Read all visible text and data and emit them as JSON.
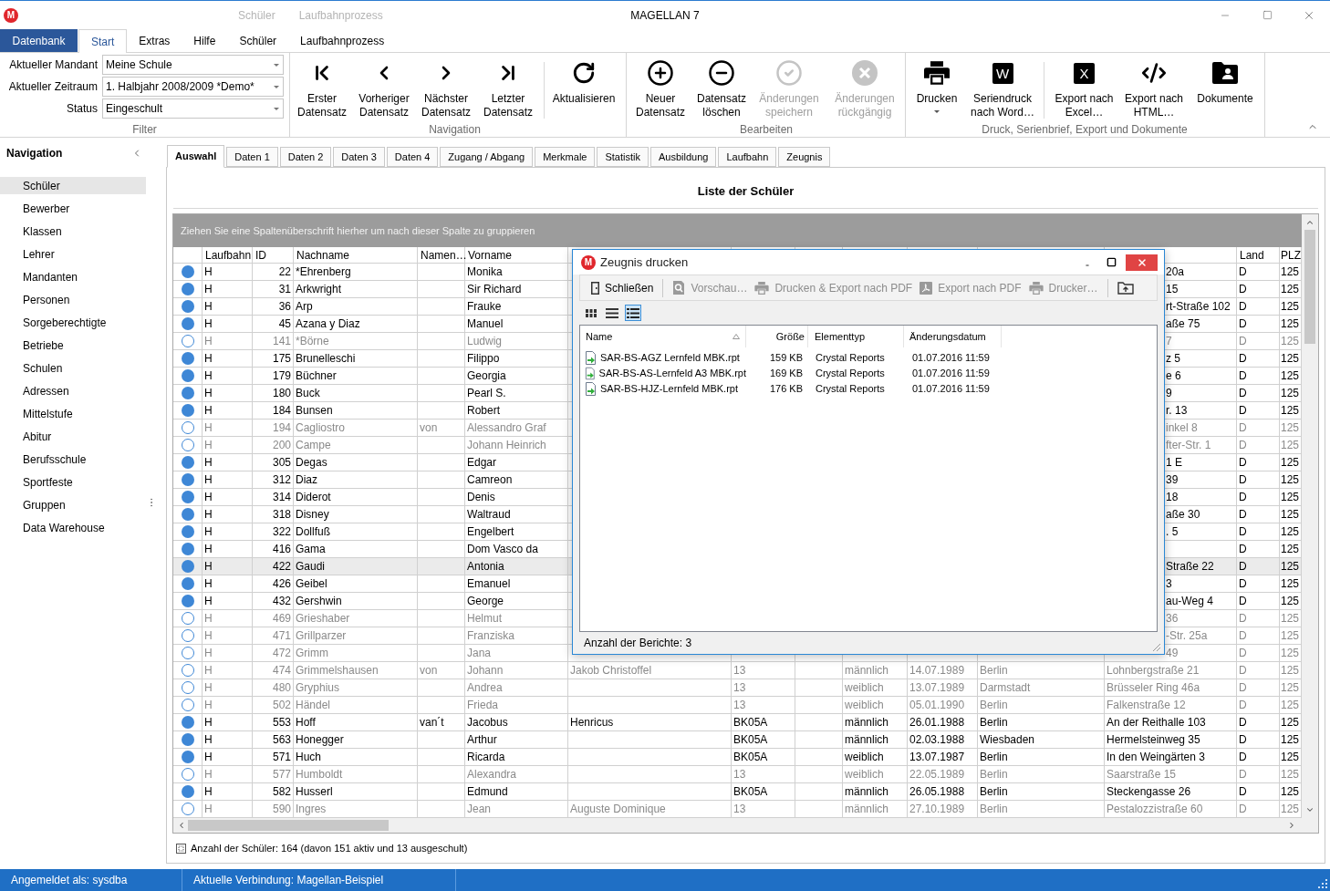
{
  "title_bar": {
    "logo": "M",
    "context_tabs": [
      "Schüler",
      "Laufbahnprozess"
    ],
    "title": "MAGELLAN 7"
  },
  "ribbon": {
    "tabs": [
      {
        "kind": "backstage",
        "label": "Datenbank",
        "selected": false
      },
      {
        "kind": "tab",
        "label": "Start",
        "selected": true
      },
      {
        "kind": "tab",
        "label": "Extras",
        "selected": false
      },
      {
        "kind": "tab",
        "label": "Hilfe",
        "selected": false
      },
      {
        "kind": "tab",
        "label": "Schüler",
        "selected": false
      },
      {
        "kind": "tab",
        "label": "Laufbahnprozess",
        "selected": false
      }
    ],
    "groups": [
      {
        "kind": "filter",
        "label": "Filter",
        "fields": [
          {
            "label": "Aktueller Mandant",
            "value": "Meine Schule"
          },
          {
            "label": "Aktueller Zeitraum",
            "value": "1. Halbjahr 2008/2009 *Demo*"
          },
          {
            "label": "Status",
            "value": "Eingeschult"
          }
        ]
      },
      {
        "kind": "buttons",
        "label": "Navigation",
        "buttons": [
          {
            "kind": "first",
            "label": "Erster\nDatensatz",
            "disabled": false
          },
          {
            "kind": "previous",
            "label": "Vorheriger\nDatensatz",
            "disabled": false
          },
          {
            "kind": "next",
            "label": "Nächster\nDatensatz",
            "disabled": false
          },
          {
            "kind": "last",
            "label": "Letzter\nDatensatz",
            "disabled": false
          },
          {
            "kind": "refresh",
            "label": "Aktualisieren",
            "disabled": false,
            "separated": true
          }
        ]
      },
      {
        "kind": "buttons",
        "label": "Bearbeiten",
        "buttons": [
          {
            "kind": "add",
            "label": "Neuer\nDatensatz",
            "disabled": false
          },
          {
            "kind": "remove",
            "label": "Datensatz\nlöschen",
            "disabled": false
          },
          {
            "kind": "save",
            "label": "Änderungen\nspeichern",
            "disabled": true
          },
          {
            "kind": "undo",
            "label": "Änderungen\nrückgängig",
            "disabled": true
          }
        ]
      },
      {
        "kind": "buttons",
        "label": "Druck, Serienbrief, Export und Dokumente",
        "buttons": [
          {
            "kind": "print",
            "label": "Drucken",
            "disabled": false,
            "dropdown": true
          },
          {
            "kind": "tile",
            "icon_text": "W",
            "label": "Seriendruck\nnach Word…",
            "disabled": false
          },
          {
            "kind": "tile",
            "icon_text": "X",
            "label": "Export nach\nExcel…",
            "disabled": false,
            "separated": true
          },
          {
            "kind": "code",
            "label": "Export nach\nHTML…",
            "disabled": false
          },
          {
            "kind": "documents",
            "label": "Dokumente",
            "disabled": false
          }
        ]
      }
    ]
  },
  "navigation": {
    "title": "Navigation",
    "items": [
      {
        "label": "Schüler",
        "selected": true
      },
      {
        "label": "Bewerber",
        "selected": false
      },
      {
        "label": "Klassen",
        "selected": false
      },
      {
        "label": "Lehrer",
        "selected": false
      },
      {
        "label": "Mandanten",
        "selected": false
      },
      {
        "label": "Personen",
        "selected": false
      },
      {
        "label": "Sorgeberechtigte",
        "selected": false
      },
      {
        "label": "Betriebe",
        "selected": false
      },
      {
        "label": "Schulen",
        "selected": false
      },
      {
        "label": "Adressen",
        "selected": false
      },
      {
        "label": "Mittelstufe",
        "selected": false
      },
      {
        "label": "Abitur",
        "selected": false
      },
      {
        "label": "Berufsschule",
        "selected": false
      },
      {
        "label": "Sportfeste",
        "selected": false
      },
      {
        "label": "Gruppen",
        "selected": false
      },
      {
        "label": "Data Warehouse",
        "selected": false
      }
    ]
  },
  "content_tabs": [
    {
      "label": "Auswahl",
      "selected": true
    },
    {
      "label": "Daten 1",
      "selected": false
    },
    {
      "label": "Daten 2",
      "selected": false
    },
    {
      "label": "Daten 3",
      "selected": false
    },
    {
      "label": "Daten 4",
      "selected": false
    },
    {
      "label": "Zugang / Abgang",
      "selected": false
    },
    {
      "label": "Merkmale",
      "selected": false
    },
    {
      "label": "Statistik",
      "selected": false
    },
    {
      "label": "Ausbildung",
      "selected": false
    },
    {
      "label": "Laufbahn",
      "selected": false
    },
    {
      "label": "Zeugnis",
      "selected": false
    }
  ],
  "list": {
    "title": "Liste der Schüler",
    "group_hint": "Ziehen Sie eine Spaltenüberschrift hierher um nach dieser Spalte zu gruppieren",
    "columns": {
      "laufbahn": "Laufbahn",
      "id": "ID",
      "nachname": "Nachname",
      "column_5": "Namen…",
      "vorname": "Vorname",
      "land": "Land",
      "column_15": "PLZ"
    },
    "rows": [
      {
        "kind": "partial",
        "active": true,
        "selected": false,
        "cells": {
          "laufbahn": "H",
          "id": "22",
          "nachname": "*Ehrenberg",
          "vorname": "Monika",
          "column_13": "20a",
          "land": "D",
          "column_15": "125"
        }
      },
      {
        "kind": "partial",
        "active": true,
        "selected": false,
        "cells": {
          "laufbahn": "H",
          "id": "31",
          "nachname": "Arkwright",
          "vorname": "Sir Richard",
          "column_13": "15",
          "land": "D",
          "column_15": "125"
        }
      },
      {
        "kind": "partial",
        "active": true,
        "selected": false,
        "cells": {
          "laufbahn": "H",
          "id": "36",
          "nachname": "Arp",
          "vorname": "Frauke",
          "column_13": "rt-Straße 102",
          "land": "D",
          "column_15": "125"
        }
      },
      {
        "kind": "partial",
        "active": true,
        "selected": false,
        "cells": {
          "laufbahn": "H",
          "id": "45",
          "nachname": "Azana y Diaz",
          "vorname": "Manuel",
          "column_13": "aße 75",
          "land": "D",
          "column_15": "125"
        }
      },
      {
        "kind": "partial",
        "active": false,
        "selected": false,
        "cells": {
          "laufbahn": "H",
          "id": "141",
          "nachname": "*Börne",
          "vorname": "Ludwig",
          "column_13": "7",
          "land": "D",
          "column_15": "125"
        }
      },
      {
        "kind": "partial",
        "active": true,
        "selected": false,
        "cells": {
          "laufbahn": "H",
          "id": "175",
          "nachname": "Brunelleschi",
          "vorname": "Filippo",
          "column_13": "z 5",
          "land": "D",
          "column_15": "125"
        }
      },
      {
        "kind": "partial",
        "active": true,
        "selected": false,
        "cells": {
          "laufbahn": "H",
          "id": "179",
          "nachname": "Büchner",
          "vorname": "Georgia",
          "column_13": "e 6",
          "land": "D",
          "column_15": "125"
        }
      },
      {
        "kind": "partial",
        "active": true,
        "selected": false,
        "cells": {
          "laufbahn": "H",
          "id": "180",
          "nachname": "Buck",
          "vorname": "Pearl S.",
          "column_13": "9",
          "land": "D",
          "column_15": "125"
        }
      },
      {
        "kind": "partial",
        "active": true,
        "selected": false,
        "cells": {
          "laufbahn": "H",
          "id": "184",
          "nachname": "Bunsen",
          "vorname": "Robert",
          "column_13": "r. 13",
          "land": "D",
          "column_15": "125"
        }
      },
      {
        "kind": "partial",
        "active": false,
        "selected": false,
        "cells": {
          "laufbahn": "H",
          "id": "194",
          "nachname": "Cagliostro",
          "column_5": "von",
          "vorname": "Alessandro Graf",
          "column_13": "inkel 8",
          "land": "D",
          "column_15": "125"
        }
      },
      {
        "kind": "partial",
        "active": false,
        "selected": false,
        "cells": {
          "laufbahn": "H",
          "id": "200",
          "nachname": "Campe",
          "vorname": "Johann Heinrich",
          "column_13": "fter-Str. 1",
          "land": "D",
          "column_15": "125"
        }
      },
      {
        "kind": "partial",
        "active": true,
        "selected": false,
        "cells": {
          "laufbahn": "H",
          "id": "305",
          "nachname": "Degas",
          "vorname": "Edgar",
          "column_13": "1 E",
          "land": "D",
          "column_15": "125"
        }
      },
      {
        "kind": "partial",
        "active": true,
        "selected": false,
        "cells": {
          "laufbahn": "H",
          "id": "312",
          "nachname": "Diaz",
          "vorname": "Camreon",
          "column_13": "39",
          "land": "D",
          "column_15": "125"
        }
      },
      {
        "kind": "partial",
        "active": true,
        "selected": false,
        "cells": {
          "laufbahn": "H",
          "id": "314",
          "nachname": "Diderot",
          "vorname": "Denis",
          "column_13": "18",
          "land": "D",
          "column_15": "125"
        }
      },
      {
        "kind": "partial",
        "active": true,
        "selected": false,
        "cells": {
          "laufbahn": "H",
          "id": "318",
          "nachname": "Disney",
          "vorname": "Waltraud",
          "column_13": "aße 30",
          "land": "D",
          "column_15": "125"
        }
      },
      {
        "kind": "partial",
        "active": true,
        "selected": false,
        "cells": {
          "laufbahn": "H",
          "id": "322",
          "nachname": "Dollfuß",
          "vorname": "Engelbert",
          "column_13": ". 5",
          "land": "D",
          "column_15": "125"
        }
      },
      {
        "kind": "partial",
        "active": true,
        "selected": false,
        "cells": {
          "laufbahn": "H",
          "id": "416",
          "nachname": "Gama",
          "vorname": "Dom Vasco da",
          "land": "D",
          "column_15": "125"
        }
      },
      {
        "kind": "partial",
        "active": true,
        "selected": true,
        "cells": {
          "laufbahn": "H",
          "id": "422",
          "nachname": "Gaudi",
          "vorname": "Antonia",
          "column_13": "Straße 22",
          "land": "D",
          "column_15": "125"
        }
      },
      {
        "kind": "partial",
        "active": true,
        "selected": false,
        "cells": {
          "laufbahn": "H",
          "id": "426",
          "nachname": "Geibel",
          "vorname": "Emanuel",
          "column_13": "3",
          "land": "D",
          "column_15": "125"
        }
      },
      {
        "kind": "partial",
        "active": true,
        "selected": false,
        "cells": {
          "laufbahn": "H",
          "id": "432",
          "nachname": "Gershwin",
          "vorname": "George",
          "column_13": "au-Weg 4",
          "land": "D",
          "column_15": "125"
        }
      },
      {
        "kind": "partial",
        "active": false,
        "selected": false,
        "cells": {
          "laufbahn": "H",
          "id": "469",
          "nachname": "Grieshaber",
          "vorname": "Helmut",
          "column_13": "36",
          "land": "D",
          "column_15": "125"
        }
      },
      {
        "kind": "partial",
        "active": false,
        "selected": false,
        "cells": {
          "laufbahn": "H",
          "id": "471",
          "nachname": "Grillparzer",
          "vorname": "Franziska",
          "column_13": "-Str. 25a",
          "land": "D",
          "column_15": "125"
        }
      },
      {
        "kind": "partial",
        "active": false,
        "selected": false,
        "cells": {
          "laufbahn": "H",
          "id": "472",
          "nachname": "Grimm",
          "vorname": "Jana",
          "column_13": "49",
          "land": "D",
          "column_15": "125"
        }
      },
      {
        "kind": "full",
        "active": false,
        "selected": false,
        "cells": {
          "laufbahn": "H",
          "id": "474",
          "nachname": "Grimmelshausen",
          "column_5": "von",
          "vorname": "Johann",
          "column_7": "Jakob Christoffel",
          "column_8": "13",
          "column_10": "männlich",
          "column_11": "14.07.1989",
          "column_12": "Berlin",
          "column_13": "Lohnbergstraße 21",
          "land": "D",
          "column_15": "125"
        }
      },
      {
        "kind": "full",
        "active": false,
        "selected": false,
        "cells": {
          "laufbahn": "H",
          "id": "480",
          "nachname": "Gryphius",
          "vorname": "Andrea",
          "column_8": "13",
          "column_10": "weiblich",
          "column_11": "13.07.1989",
          "column_12": "Darmstadt",
          "column_13": "Brüsseler Ring 46a",
          "land": "D",
          "column_15": "125"
        }
      },
      {
        "kind": "full",
        "active": false,
        "selected": false,
        "cells": {
          "laufbahn": "H",
          "id": "502",
          "nachname": "Händel",
          "vorname": "Frieda",
          "column_8": "13",
          "column_10": "weiblich",
          "column_11": "05.01.1990",
          "column_12": "Berlin",
          "column_13": "Falkenstraße 12",
          "land": "D",
          "column_15": "125"
        }
      },
      {
        "kind": "full",
        "active": true,
        "selected": false,
        "cells": {
          "laufbahn": "H",
          "id": "553",
          "nachname": "Hoff",
          "column_5": "van´t",
          "vorname": "Jacobus",
          "column_7": "Henricus",
          "column_8": "BK05A",
          "column_10": "männlich",
          "column_11": "26.01.1988",
          "column_12": "Berlin",
          "column_13": "An der Reithalle 103",
          "land": "D",
          "column_15": "125"
        }
      },
      {
        "kind": "full",
        "active": true,
        "selected": false,
        "cells": {
          "laufbahn": "H",
          "id": "563",
          "nachname": "Honegger",
          "vorname": "Arthur",
          "column_8": "BK05A",
          "column_10": "männlich",
          "column_11": "02.03.1988",
          "column_12": "Wiesbaden",
          "column_13": "Hermelsteinweg 35",
          "land": "D",
          "column_15": "125"
        }
      },
      {
        "kind": "full",
        "active": true,
        "selected": false,
        "cells": {
          "laufbahn": "H",
          "id": "571",
          "nachname": "Huch",
          "vorname": "Ricarda",
          "column_8": "BK05A",
          "column_10": "weiblich",
          "column_11": "13.07.1987",
          "column_12": "Berlin",
          "column_13": "In den Weingärten 3",
          "land": "D",
          "column_15": "125"
        }
      },
      {
        "kind": "full",
        "active": false,
        "selected": false,
        "cells": {
          "laufbahn": "H",
          "id": "577",
          "nachname": "Humboldt",
          "vorname": "Alexandra",
          "column_8": "13",
          "column_10": "weiblich",
          "column_11": "22.05.1989",
          "column_12": "Berlin",
          "column_13": "Saarstraße 15",
          "land": "D",
          "column_15": "125"
        }
      },
      {
        "kind": "full",
        "active": true,
        "selected": false,
        "cells": {
          "laufbahn": "H",
          "id": "582",
          "nachname": "Husserl",
          "vorname": "Edmund",
          "column_8": "BK05A",
          "column_10": "männlich",
          "column_11": "26.05.1988",
          "column_12": "Berlin",
          "column_13": "Steckengasse 26",
          "land": "D",
          "column_15": "125"
        }
      },
      {
        "kind": "full",
        "active": false,
        "selected": false,
        "cells": {
          "laufbahn": "H",
          "id": "590",
          "nachname": "Ingres",
          "vorname": "Jean",
          "column_7": "Auguste Dominique",
          "column_8": "13",
          "column_10": "männlich",
          "column_11": "27.10.1989",
          "column_12": "Berlin",
          "column_13": "Pestalozzistraße 60",
          "land": "D",
          "column_15": "125"
        }
      }
    ],
    "footer": "Anzahl der Schüler: 164 (davon 151 aktiv und 13 ausgeschult)"
  },
  "dialog": {
    "logo": "M",
    "title": "Zeugnis drucken",
    "toolbar": [
      {
        "kind": "door",
        "label": "Schließen",
        "disabled": false
      },
      {
        "kind": "preview",
        "label": "Vorschau…",
        "disabled": true,
        "separated": true
      },
      {
        "kind": "print",
        "label": "Drucken & Export nach PDF",
        "disabled": true
      },
      {
        "kind": "pdf",
        "label": "Export nach PDF",
        "disabled": true
      },
      {
        "kind": "printer",
        "label": "Drucker…",
        "disabled": true
      },
      {
        "kind": "upload",
        "disabled": false,
        "separated": true
      }
    ],
    "views": [
      {
        "kind": "tiles",
        "selected": false
      },
      {
        "kind": "list",
        "selected": false
      },
      {
        "kind": "details",
        "selected": true
      }
    ],
    "columns": [
      "Name",
      "Größe",
      "Elementtyp",
      "Änderungsdatum"
    ],
    "files": [
      {
        "name": "SAR-BS-AGZ Lernfeld MBK.rpt",
        "size": "159 KB",
        "type": "Crystal Reports",
        "modified": "01.07.2016 11:59"
      },
      {
        "name": "SAR-BS-AS-Lernfeld A3 MBK.rpt",
        "size": "169 KB",
        "type": "Crystal Reports",
        "modified": "01.07.2016 11:59"
      },
      {
        "name": "SAR-BS-HJZ-Lernfeld MBK.rpt",
        "size": "176 KB",
        "type": "Crystal Reports",
        "modified": "01.07.2016 11:59"
      }
    ],
    "footer": "Anzahl der Berichte: 3"
  },
  "status_bar": {
    "items": [
      "Angemeldet als: sysdba",
      "Aktuelle Verbindung: Magellan-Beispiel"
    ]
  }
}
